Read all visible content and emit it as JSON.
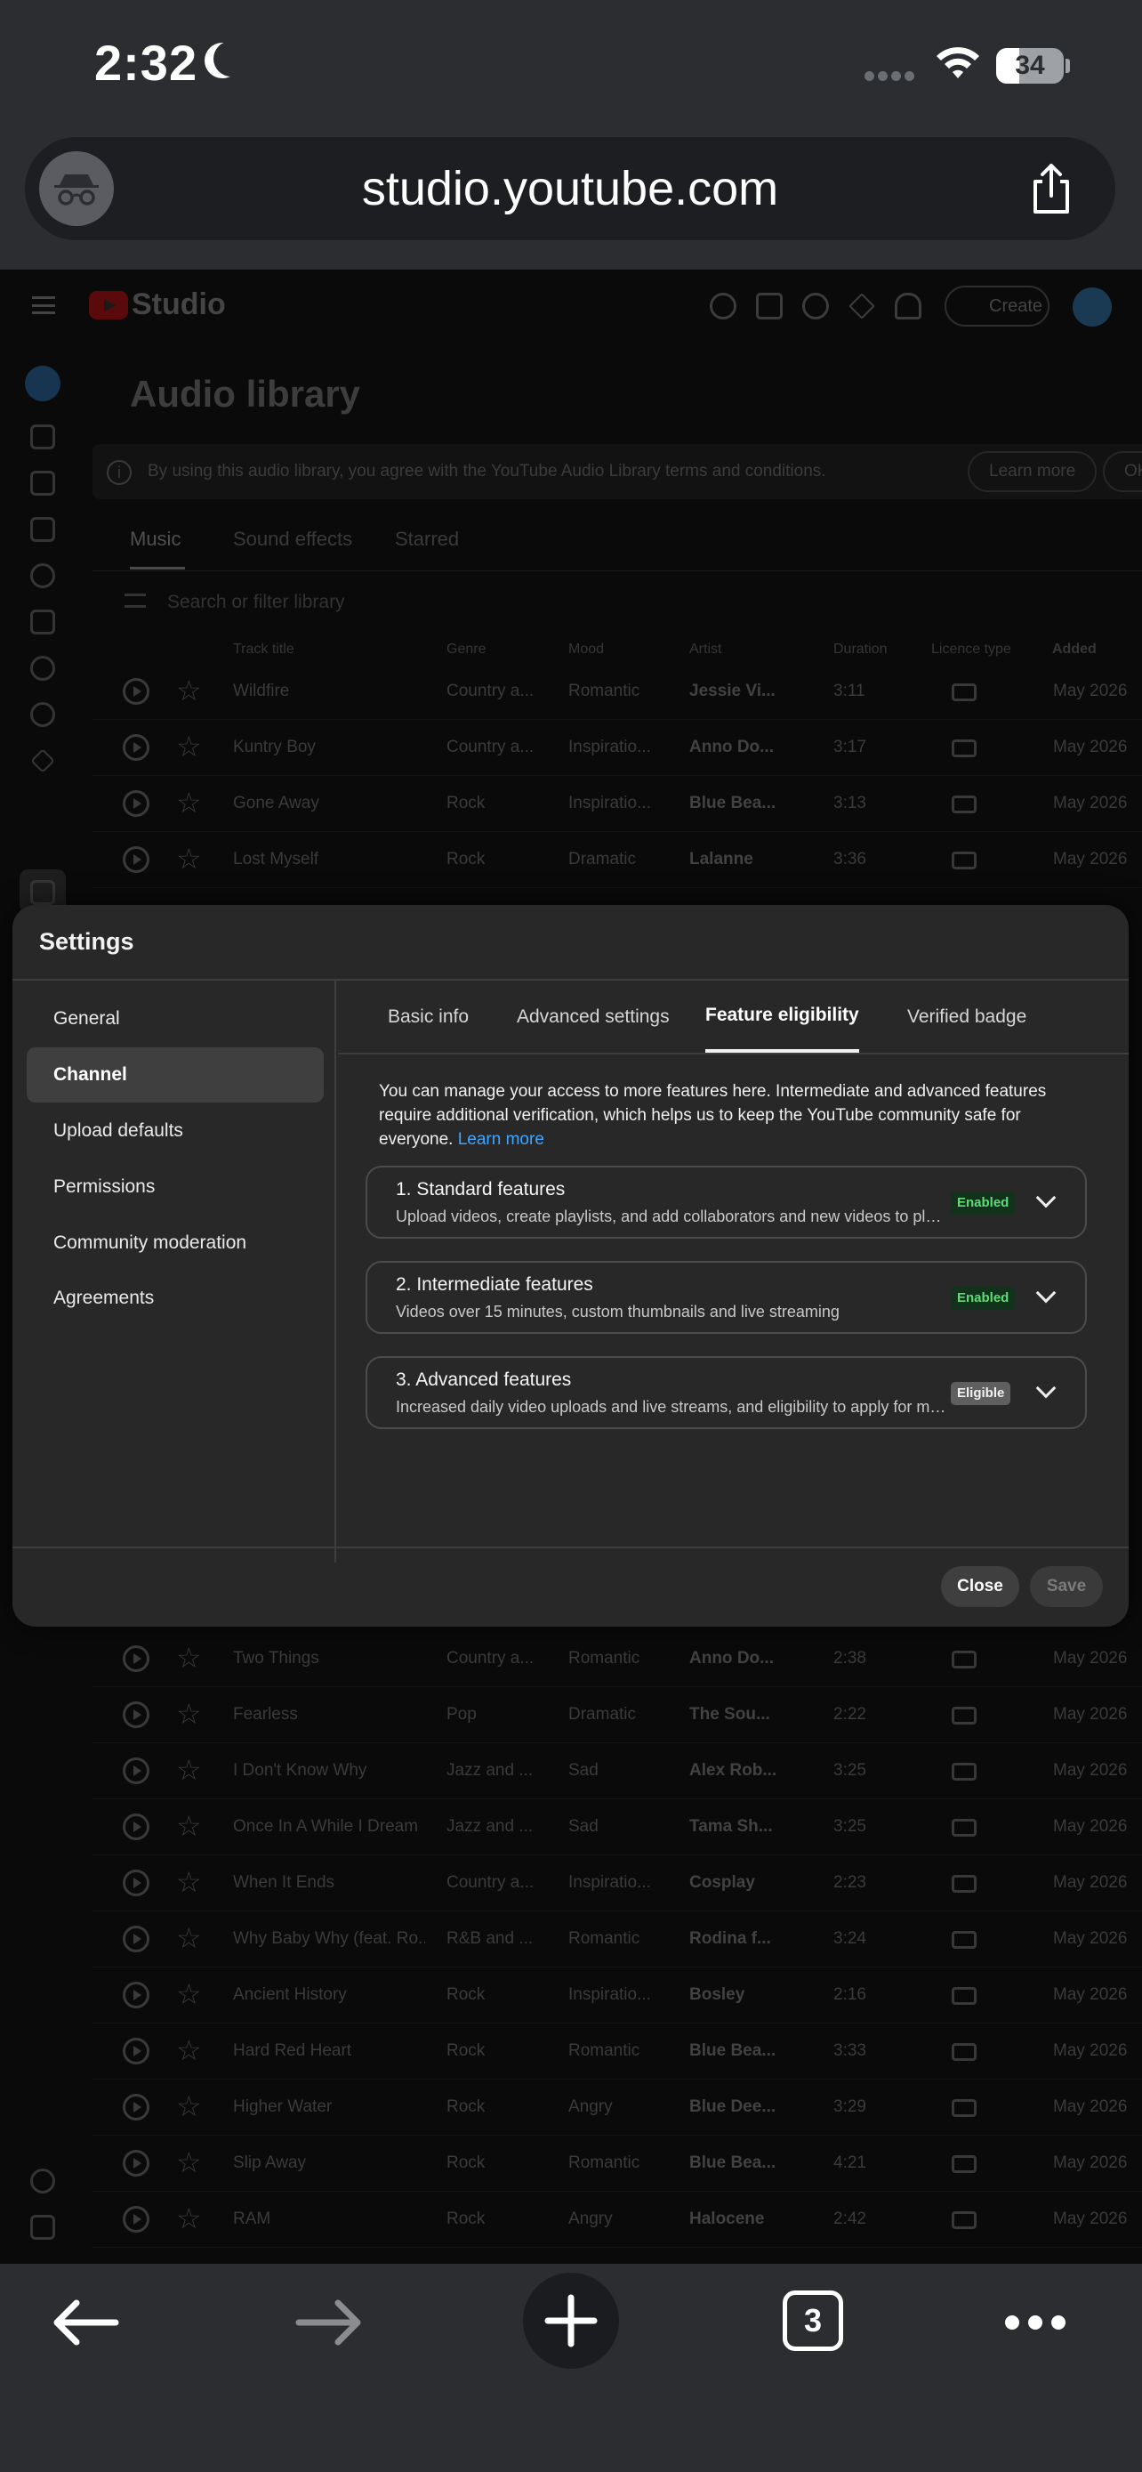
{
  "status_bar": {
    "time": "2:32",
    "battery": "34",
    "battery_level": 0.34
  },
  "browser": {
    "url": "studio.youtube.com",
    "tab_count": "3"
  },
  "studio": {
    "logo_text": "Studio",
    "create_label": "Create",
    "page_title": "Audio library",
    "notice": {
      "text": "By using this audio library, you agree with the YouTube Audio Library terms and conditions.",
      "learn_more": "Learn more",
      "ok": "OK"
    },
    "tabs": [
      "Music",
      "Sound effects",
      "Starred"
    ],
    "search_placeholder": "Search or filter library",
    "columns": {
      "track_title": "Track title",
      "genre": "Genre",
      "mood": "Mood",
      "artist": "Artist",
      "duration": "Duration",
      "licence_type": "Licence type",
      "added": "Added"
    },
    "tracks_top": [
      {
        "title": "Wildfire",
        "genre": "Country a...",
        "mood": "Romantic",
        "artist": "Jessie Vi...",
        "duration": "3:11",
        "added": "May 2026"
      },
      {
        "title": "Kuntry Boy",
        "genre": "Country a...",
        "mood": "Inspiratio...",
        "artist": "Anno Do...",
        "duration": "3:17",
        "added": "May 2026"
      },
      {
        "title": "Gone Away",
        "genre": "Rock",
        "mood": "Inspiratio...",
        "artist": "Blue Bea...",
        "duration": "3:13",
        "added": "May 2026"
      },
      {
        "title": "Lost Myself",
        "genre": "Rock",
        "mood": "Dramatic",
        "artist": "Lalanne",
        "duration": "3:36",
        "added": "May 2026"
      }
    ],
    "tracks_bottom": [
      {
        "title": "Two Things",
        "genre": "Country a...",
        "mood": "Romantic",
        "artist": "Anno Do...",
        "duration": "2:38",
        "added": "May 2026"
      },
      {
        "title": "Fearless",
        "genre": "Pop",
        "mood": "Dramatic",
        "artist": "The Sou...",
        "duration": "2:22",
        "added": "May 2026"
      },
      {
        "title": "I Don't Know Why",
        "genre": "Jazz and ...",
        "mood": "Sad",
        "artist": "Alex Rob...",
        "duration": "3:25",
        "added": "May 2026"
      },
      {
        "title": "Once In A While I Dream",
        "genre": "Jazz and ...",
        "mood": "Sad",
        "artist": "Tama Sh...",
        "duration": "3:25",
        "added": "May 2026"
      },
      {
        "title": "When It Ends",
        "genre": "Country a...",
        "mood": "Inspiratio...",
        "artist": "Cosplay",
        "duration": "2:23",
        "added": "May 2026"
      },
      {
        "title": "Why Baby Why (feat. Ro...",
        "genre": "R&B and ...",
        "mood": "Romantic",
        "artist": "Rodina f...",
        "duration": "3:24",
        "added": "May 2026"
      },
      {
        "title": "Ancient History",
        "genre": "Rock",
        "mood": "Inspiratio...",
        "artist": "Bosley",
        "duration": "2:16",
        "added": "May 2026"
      },
      {
        "title": "Hard Red Heart",
        "genre": "Rock",
        "mood": "Romantic",
        "artist": "Blue Bea...",
        "duration": "3:33",
        "added": "May 2026"
      },
      {
        "title": "Higher Water",
        "genre": "Rock",
        "mood": "Angry",
        "artist": "Blue Dee...",
        "duration": "3:29",
        "added": "May 2026"
      },
      {
        "title": "Slip Away",
        "genre": "Rock",
        "mood": "Romantic",
        "artist": "Blue Bea...",
        "duration": "4:21",
        "added": "May 2026"
      },
      {
        "title": "RAM",
        "genre": "Rock",
        "mood": "Angry",
        "artist": "Halocene",
        "duration": "2:42",
        "added": "May 2026"
      }
    ]
  },
  "settings": {
    "title": "Settings",
    "nav": [
      "General",
      "Channel",
      "Upload defaults",
      "Permissions",
      "Community moderation",
      "Agreements"
    ],
    "active_nav": "Channel",
    "tabs": [
      "Basic info",
      "Advanced settings",
      "Feature eligibility",
      "Verified badge"
    ],
    "active_tab": "Feature eligibility",
    "intro": "You can manage your access to more features here. Intermediate and advanced features require additional verification, which helps us to keep the YouTube community safe for everyone.",
    "intro_link": "Learn more",
    "features": [
      {
        "title": "1. Standard features",
        "desc": "Upload videos, create playlists, and add collaborators and new videos to playlists",
        "status": "Enabled"
      },
      {
        "title": "2. Intermediate features",
        "desc": "Videos over 15 minutes, custom thumbnails and live streaming",
        "status": "Enabled"
      },
      {
        "title": "3. Advanced features",
        "desc": "Increased daily video uploads and live streams, and eligibility to apply for monetisation",
        "status": "Eligible"
      }
    ],
    "close_label": "Close",
    "save_label": "Save"
  },
  "colors": {
    "link": "#3ea6ff",
    "enabled_text": "#5fdc7a",
    "enabled_bg": "#13321c",
    "youtube_red": "#ff0000"
  },
  "icons": [
    "incognito-icon",
    "share-icon",
    "back-icon",
    "forward-icon",
    "new-tab-icon",
    "tabs-icon",
    "more-icon"
  ]
}
